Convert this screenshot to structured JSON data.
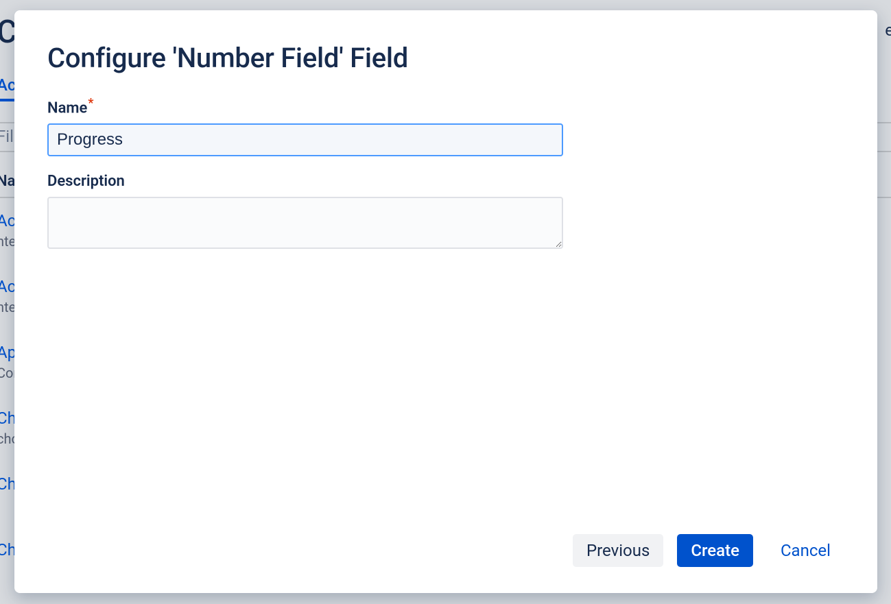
{
  "background": {
    "page_title_fragment": "Cu",
    "right_fragment": "e",
    "tab_fragment": "Act",
    "filter_fragment": "Fil",
    "colhead_fragment": "Nar",
    "rows": [
      {
        "link": "Act",
        "sub": "nte"
      },
      {
        "link": "Act",
        "sub": "nte"
      },
      {
        "link": "Apr",
        "sub": "Con"
      },
      {
        "link": "Cha",
        "sub": "cho"
      },
      {
        "link": "Cha",
        "sub": ""
      },
      {
        "link": "Cha",
        "sub": ""
      }
    ]
  },
  "modal": {
    "title": "Configure 'Number Field' Field",
    "name_label": "Name",
    "required_mark": "*",
    "name_value": "Progress",
    "description_label": "Description",
    "description_value": "",
    "buttons": {
      "previous": "Previous",
      "create": "Create",
      "cancel": "Cancel"
    }
  }
}
